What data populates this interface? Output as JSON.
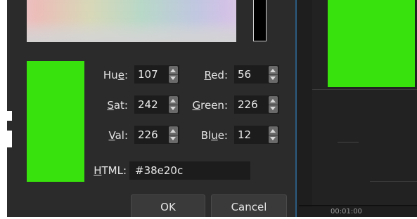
{
  "color_picker": {
    "hue_label_pre": "Hu",
    "hue_label_u": "e",
    "hue_label_post": ":",
    "hue_value": "107",
    "sat_label_u": "S",
    "sat_label_post": "at:",
    "sat_value": "242",
    "val_label_u": "V",
    "val_label_post": "al:",
    "val_value": "226",
    "red_label_u": "R",
    "red_label_post": "ed:",
    "red_value": "56",
    "green_label_u": "G",
    "green_label_post": "reen:",
    "green_value": "226",
    "blue_label_pre": "Bl",
    "blue_label_u": "u",
    "blue_label_post": "e:",
    "blue_value": "12",
    "html_label_u": "H",
    "html_label_post": "TML:",
    "html_value": "#38e20c",
    "current_color": "#38e20c"
  },
  "buttons": {
    "ok_label": "OK",
    "cancel_label": "Cancel"
  },
  "preview_panel": {
    "timecode": "00:01:00",
    "preview_color": "#38e20c"
  }
}
